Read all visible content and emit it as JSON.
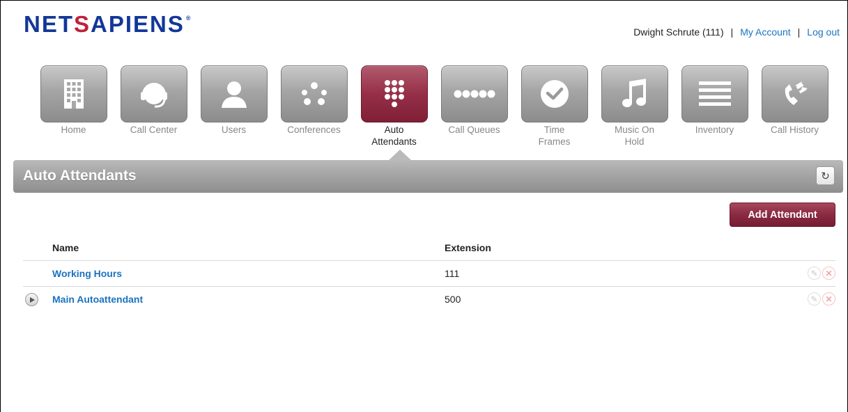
{
  "brand": {
    "logo_text_a": "NET",
    "logo_text_s": "S",
    "logo_text_b": "APIENS",
    "logo_reg": "®"
  },
  "userbar": {
    "user": "Dwight Schrute (111)",
    "separator": "|",
    "my_account": "My Account",
    "logout": "Log out"
  },
  "nav": [
    {
      "label": "Home",
      "icon": "building-icon",
      "active": false
    },
    {
      "label": "Call Center",
      "icon": "headset-icon",
      "active": false
    },
    {
      "label": "Users",
      "icon": "user-icon",
      "active": false
    },
    {
      "label": "Conferences",
      "icon": "conference-dots-icon",
      "active": false
    },
    {
      "label": "Auto Attendants",
      "icon": "keypad-icon",
      "active": true
    },
    {
      "label": "Call Queues",
      "icon": "queue-dots-icon",
      "active": false
    },
    {
      "label": "Time Frames",
      "icon": "clock-check-icon",
      "active": false
    },
    {
      "label": "Music On Hold",
      "icon": "music-note-icon",
      "active": false
    },
    {
      "label": "Inventory",
      "icon": "list-lines-icon",
      "active": false
    },
    {
      "label": "Call History",
      "icon": "phone-history-icon",
      "active": false
    }
  ],
  "section": {
    "title": "Auto Attendants",
    "refresh_icon": "refresh-icon"
  },
  "add_button": "Add Attendant",
  "table": {
    "headers": {
      "name": "Name",
      "extension": "Extension"
    },
    "rows": [
      {
        "name": "Working Hours",
        "extension": "111",
        "has_play": false
      },
      {
        "name": "Main Autoattendant",
        "extension": "500",
        "has_play": true
      }
    ]
  },
  "colors": {
    "brand_blue": "#12379a",
    "brand_red": "#c0213b",
    "link": "#1a73c0",
    "active_tab": "#962f47"
  }
}
